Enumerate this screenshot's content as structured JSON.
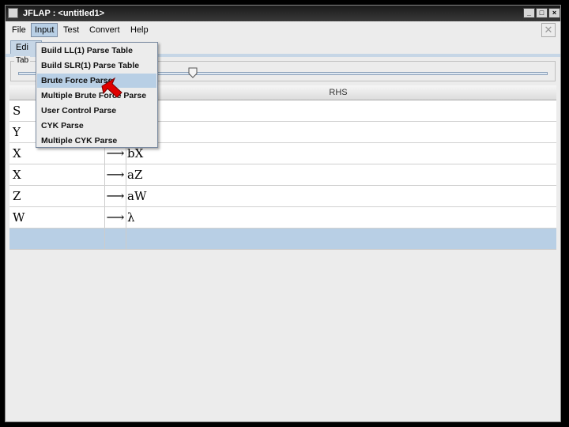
{
  "window": {
    "title": "JFLAP : <untitled1>"
  },
  "menubar": {
    "items": [
      "File",
      "Input",
      "Test",
      "Convert",
      "Help"
    ]
  },
  "tab": {
    "label": "Edi"
  },
  "group": {
    "label": "Tab"
  },
  "table": {
    "rhs_header": "RHS",
    "rows": [
      {
        "lhs": "S",
        "arrow": "",
        "rhs": ""
      },
      {
        "lhs": "Y",
        "arrow": "",
        "rhs": ""
      },
      {
        "lhs": "X",
        "arrow": "⟶",
        "rhs": "bX"
      },
      {
        "lhs": "X",
        "arrow": "⟶",
        "rhs": "aZ"
      },
      {
        "lhs": "Z",
        "arrow": "⟶",
        "rhs": "aW"
      },
      {
        "lhs": "W",
        "arrow": "⟶",
        "rhs": "λ"
      }
    ]
  },
  "input_menu": {
    "items": [
      "Build LL(1) Parse Table",
      "Build SLR(1) Parse Table",
      "Brute Force Parse",
      "Multiple Brute Force Parse",
      "User Control Parse",
      "CYK Parse",
      "Multiple CYK Parse"
    ],
    "highlighted_index": 2
  },
  "icons": {
    "minimize": "minimize-icon",
    "maximize": "maximize-icon",
    "close": "close-icon",
    "pointer": "red-arrow-pointer-icon"
  },
  "colors": {
    "selection": "#b8cfe5",
    "titlebar": "#1a1a1a",
    "pointer": "#e00000"
  }
}
